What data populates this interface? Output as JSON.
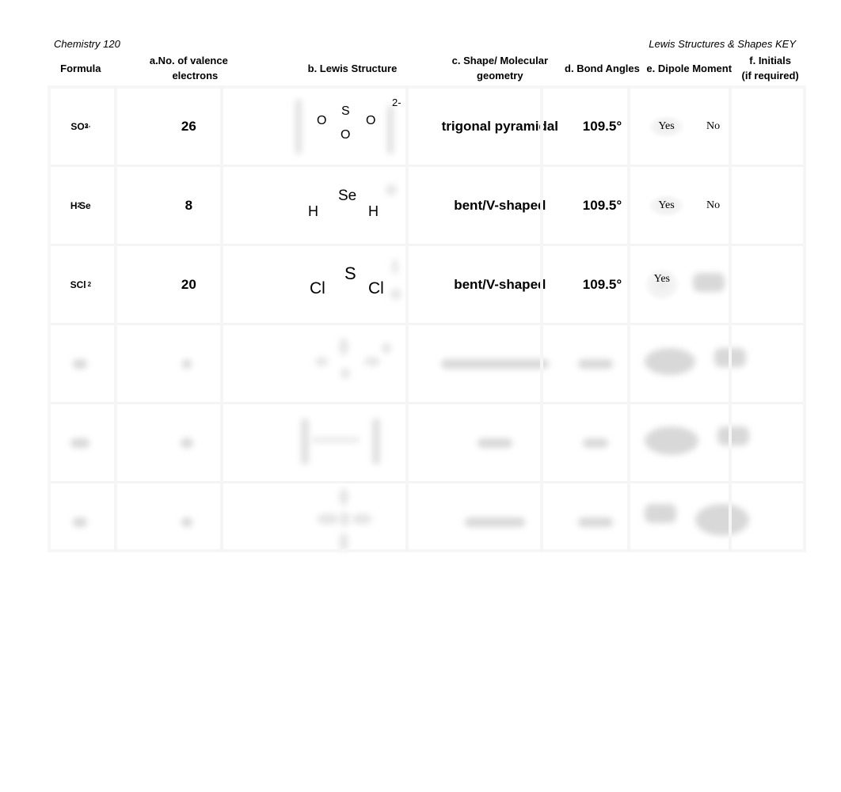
{
  "header": {
    "course": "Chemistry 120",
    "title": "Lewis Structures & Shapes KEY"
  },
  "table": {
    "columns": [
      "Formula",
      "a.No. of valence electrons",
      "b.  Lewis Structure",
      "c. Shape/ Molecular geometry",
      "d. Bond Angles",
      "e. Dipole Moment",
      "f. Initials (if required)"
    ],
    "column_lines": {
      "valence_1": "a.No. of valence",
      "valence_2": "electrons",
      "shape_1": "c. Shape/ Molecular",
      "shape_2": "geometry",
      "initials_1": "f. Initials",
      "initials_2": "(if required)"
    },
    "rows": [
      {
        "formula": {
          "base": "SO",
          "sub": "3",
          "sup": "2-"
        },
        "valence": "26",
        "lewis": {
          "central": "S",
          "ligands": [
            "O",
            "O",
            "O"
          ],
          "charge": "2-"
        },
        "shape": "trigonal pyramidal",
        "angle": "109.5°",
        "dipole_yes": "Yes",
        "dipole_no": "No",
        "dipole_selected": "Yes",
        "initials": ""
      },
      {
        "formula": {
          "pre": "H",
          "sub": "2",
          "post": "Se"
        },
        "valence": "8",
        "lewis": {
          "central": "Se",
          "ligands": [
            "H",
            "H"
          ]
        },
        "shape": "bent/V-shaped",
        "angle": "109.5°",
        "dipole_yes": "Yes",
        "dipole_no": "No",
        "dipole_selected": "Yes",
        "initials": ""
      },
      {
        "formula": {
          "base": "SCl",
          "sub": "2"
        },
        "valence": "20",
        "lewis": {
          "central": "S",
          "ligands": [
            "Cl",
            "Cl"
          ]
        },
        "shape": "bent/V-shaped",
        "angle": "109.5°",
        "dipole_yes": "Yes",
        "dipole_no": "",
        "dipole_selected": "Yes",
        "initials": ""
      },
      {
        "blurred": true
      },
      {
        "blurred": true
      },
      {
        "blurred": true
      }
    ]
  }
}
